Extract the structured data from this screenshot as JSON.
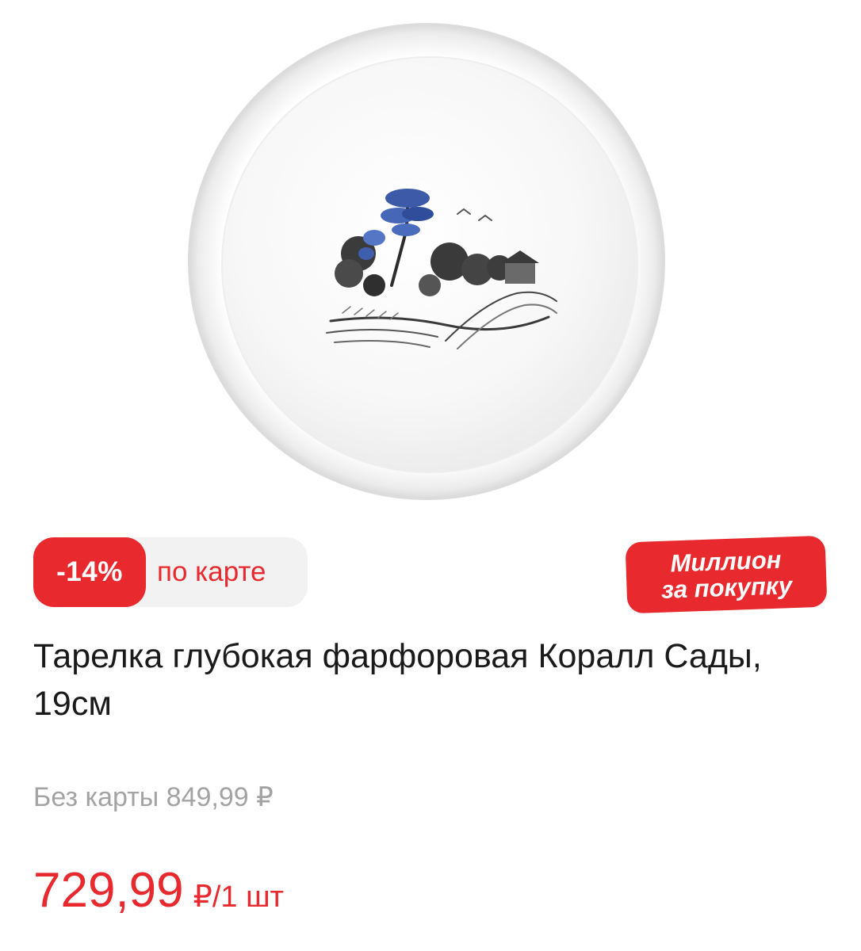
{
  "product": {
    "image_alt": "Тарелка глубокая фарфоровая Коралл Сады, 19см",
    "title": "Тарелка глубокая фарфоровая Коралл Сады, 19см"
  },
  "discount": {
    "percent": "-14%",
    "label": "по карте"
  },
  "promo_badge": {
    "line1": "Миллион",
    "line2": "за покупку"
  },
  "pricing": {
    "without_card": "Без карты 849,99 ₽",
    "card_price": "729,99",
    "card_unit": "₽/1 шт"
  },
  "colors": {
    "accent_red": "#e8292e",
    "pill_bg": "#f2f2f2",
    "muted_text": "#a3a3a3"
  }
}
